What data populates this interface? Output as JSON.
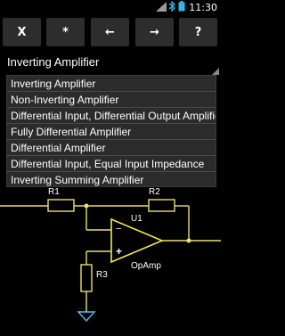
{
  "status_bar": {
    "time": "11:30",
    "icons": [
      "signal-icon",
      "bluetooth-icon",
      "battery-icon"
    ]
  },
  "toolbar": {
    "buttons": [
      {
        "label": "X"
      },
      {
        "label": "*"
      },
      {
        "label": "←"
      },
      {
        "label": "→"
      },
      {
        "label": "?"
      }
    ]
  },
  "spinner": {
    "selected": "Inverting Amplifier"
  },
  "dropdown": {
    "options": [
      "Inverting Amplifier",
      "Non-Inverting Amplifier",
      "Differential Input, Differential Output Amplifier",
      "Fully Differential Amplifier",
      "Differential Amplifier",
      "Differential Input, Equal Input Impedance",
      "Inverting Summing Amplifier"
    ]
  },
  "schematic": {
    "labels": {
      "r1": "R1",
      "r2": "R2",
      "r3": "R3",
      "u1": "U1",
      "opamp": "OpAmp",
      "minus": "−",
      "plus": "+"
    },
    "wire_color": "#e8e070",
    "body_color": "#f4e94a"
  }
}
